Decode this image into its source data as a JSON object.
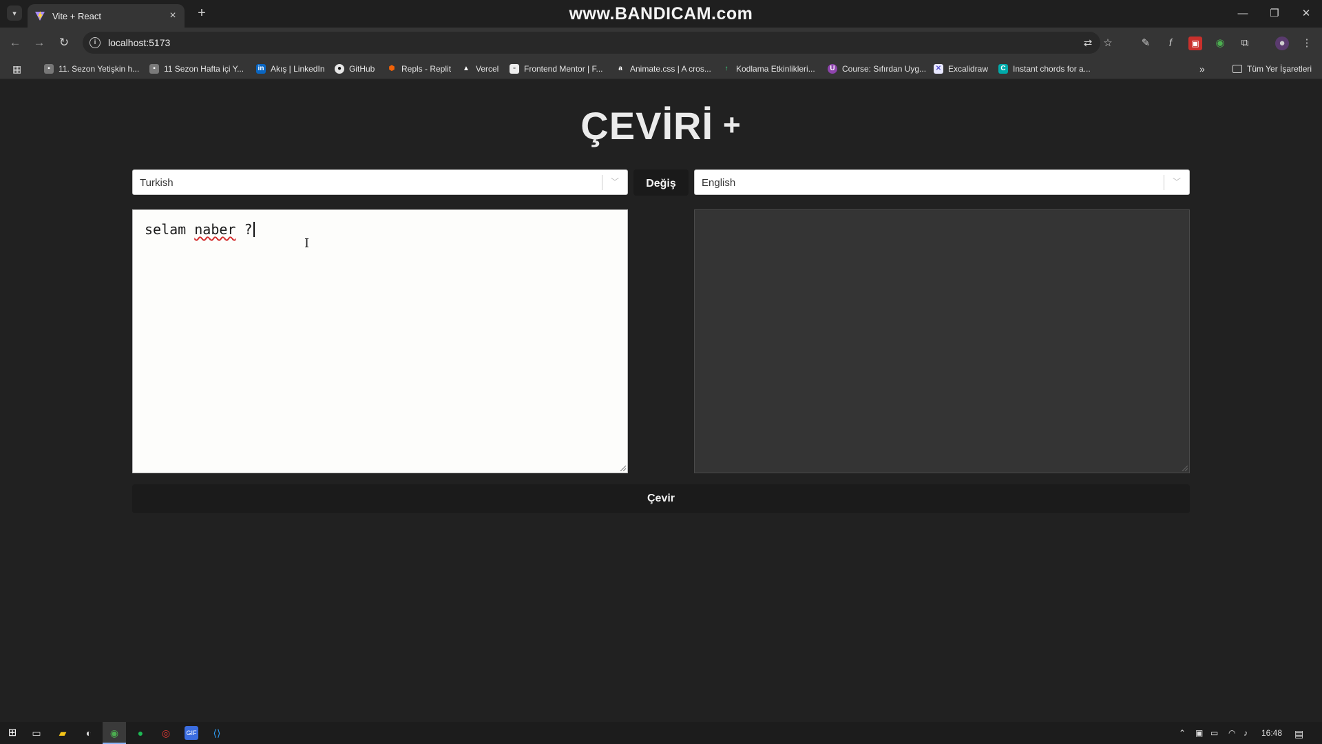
{
  "browser": {
    "tab_title": "Vite + React",
    "url": "localhost:5173",
    "watermark": "www.BANDICAM.com",
    "bookmarks": [
      "11. Sezon Yetişkin h...",
      "11 Sezon Hafta içi Y...",
      "Akış | LinkedIn",
      "GitHub",
      "Repls - Replit",
      "Vercel",
      "Frontend Mentor | F...",
      "Animate.css | A cros...",
      "Kodlama Etkinlikleri...",
      "Course: Sıfırdan Uyg...",
      "Excalidraw",
      "Instant chords for a..."
    ],
    "all_bookmarks": "Tüm Yer İşaretleri"
  },
  "app": {
    "title": "ÇEVİRİ",
    "title_plus": "+",
    "source_language": "Turkish",
    "target_language": "English",
    "swap_label": "Değiş",
    "input_text_before": "selam ",
    "input_text_misspelled": "naber",
    "input_text_after": " ?",
    "output_text": "",
    "translate_label": "Çevir"
  },
  "taskbar": {
    "time": "16:48"
  }
}
